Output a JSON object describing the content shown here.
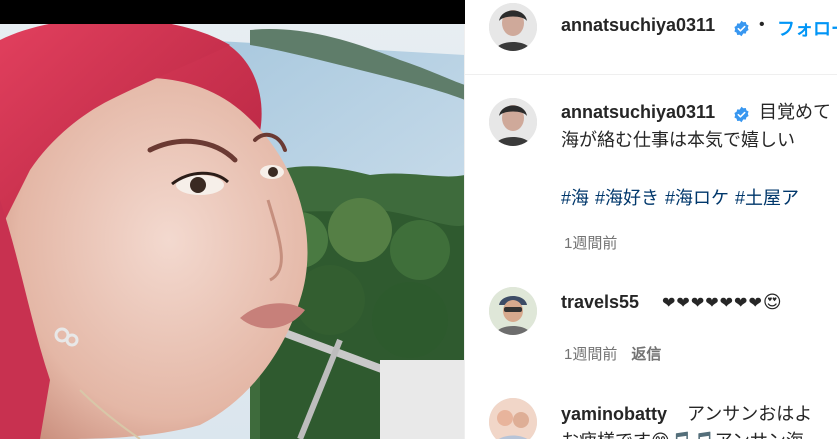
{
  "header": {
    "username": "annatsuchiya0311",
    "separator": "•",
    "follow_label": "フォロー"
  },
  "caption": {
    "username": "annatsuchiya0311",
    "line1": "目覚めて",
    "line2": "海が絡む仕事は本気で嬉しい",
    "hashtags": [
      "#海",
      "#海好き",
      "#海ロケ",
      "#土屋ア"
    ],
    "time": "1週間前"
  },
  "comments": [
    {
      "username": "travels55",
      "text": "❤❤❤❤❤❤❤",
      "emoji": "😍",
      "time": "1週間前",
      "reply_label": "返信"
    },
    {
      "username": "yaminobatty",
      "text": "アンサンおはよ",
      "line2": "お疲様です😊🎵🎵アンサン海"
    }
  ],
  "colors": {
    "accent": "#0095f6",
    "hashtag": "#00376b",
    "verified": "#3897f0",
    "hair": "#e2405e"
  },
  "icons": {
    "verified": "verified-badge-icon"
  }
}
